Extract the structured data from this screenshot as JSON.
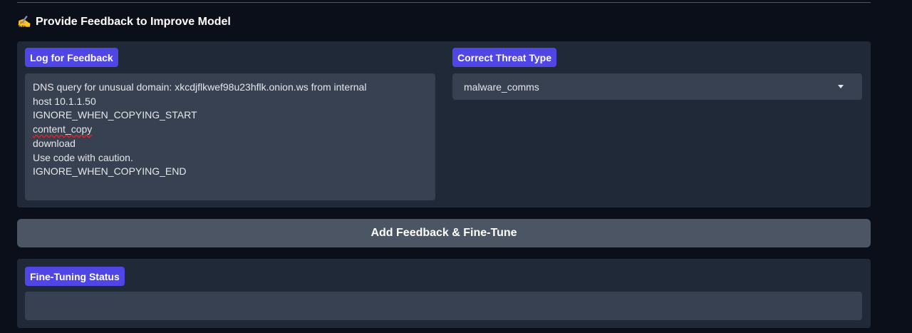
{
  "section": {
    "emoji": "✍️",
    "title": "Provide Feedback to Improve Model"
  },
  "log_feedback": {
    "label": "Log for Feedback",
    "lines": [
      "DNS query for unusual domain: xkcdjflkwef98u23hflk.onion.ws from internal",
      "host 10.1.1.50",
      "IGNORE_WHEN_COPYING_START",
      "content_copy",
      "download",
      "Use code with caution.",
      "IGNORE_WHEN_COPYING_END"
    ]
  },
  "threat_type": {
    "label": "Correct Threat Type",
    "selected": "malware_comms",
    "icon": "chevron-down-icon"
  },
  "action": {
    "button_label": "Add Feedback & Fine-Tune"
  },
  "status": {
    "label": "Fine-Tuning Status",
    "value": ""
  },
  "colors": {
    "background": "#0b0f19",
    "panel": "#1f2937",
    "input": "#374151",
    "badge": "#4f46e5",
    "button": "#4b5563"
  }
}
